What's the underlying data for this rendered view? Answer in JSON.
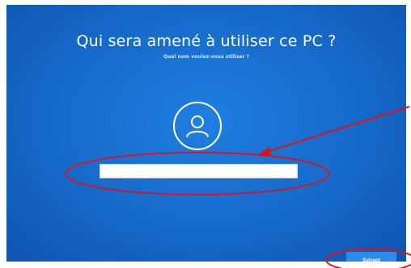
{
  "header": {
    "title": "Qui sera amené à utiliser ce PC ?",
    "subtitle": "Quel nom voulez-vous utiliser ?"
  },
  "form": {
    "name_value": "",
    "name_placeholder": ""
  },
  "footer": {
    "next_label": "Suivant"
  },
  "icons": {
    "avatar": "user-icon"
  },
  "colors": {
    "background": "#1669c9",
    "annotation": "#e0101a"
  }
}
